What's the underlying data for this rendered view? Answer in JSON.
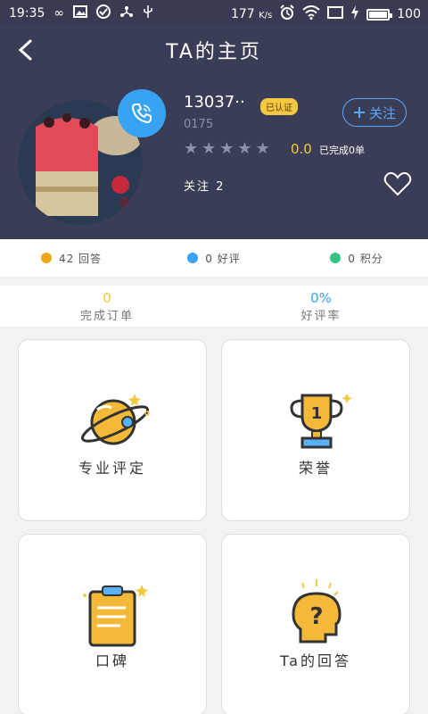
{
  "status_bar": {
    "time": "19:35",
    "speed": "177",
    "speed_unit": "K/s",
    "battery": "100"
  },
  "header": {
    "title": "TA的主页",
    "back_icon": "chevron-left-icon"
  },
  "profile": {
    "name": "13037··",
    "verified_badge": "已认证",
    "uid": "0175",
    "follow_label": "关注",
    "rating_value": "0.0",
    "stars": 5,
    "completed_label": "已完成0单",
    "following_text": "关注 2"
  },
  "stats": [
    {
      "label": "42 回答",
      "color": "#f0a81a"
    },
    {
      "label": "0 好评",
      "color": "#38a3f2"
    },
    {
      "label": "0 积分",
      "color": "#34c285"
    }
  ],
  "metrics": {
    "orders_value": "0",
    "orders_label": "完成订单",
    "rate_value": "0%",
    "rate_label": "好评率"
  },
  "cards": [
    {
      "label": "专业评定",
      "icon": "planet-icon"
    },
    {
      "label": "荣誉",
      "icon": "trophy-icon"
    },
    {
      "label": "口碑",
      "icon": "clipboard-icon"
    },
    {
      "label": "Ta的回答",
      "icon": "question-head-icon"
    }
  ]
}
